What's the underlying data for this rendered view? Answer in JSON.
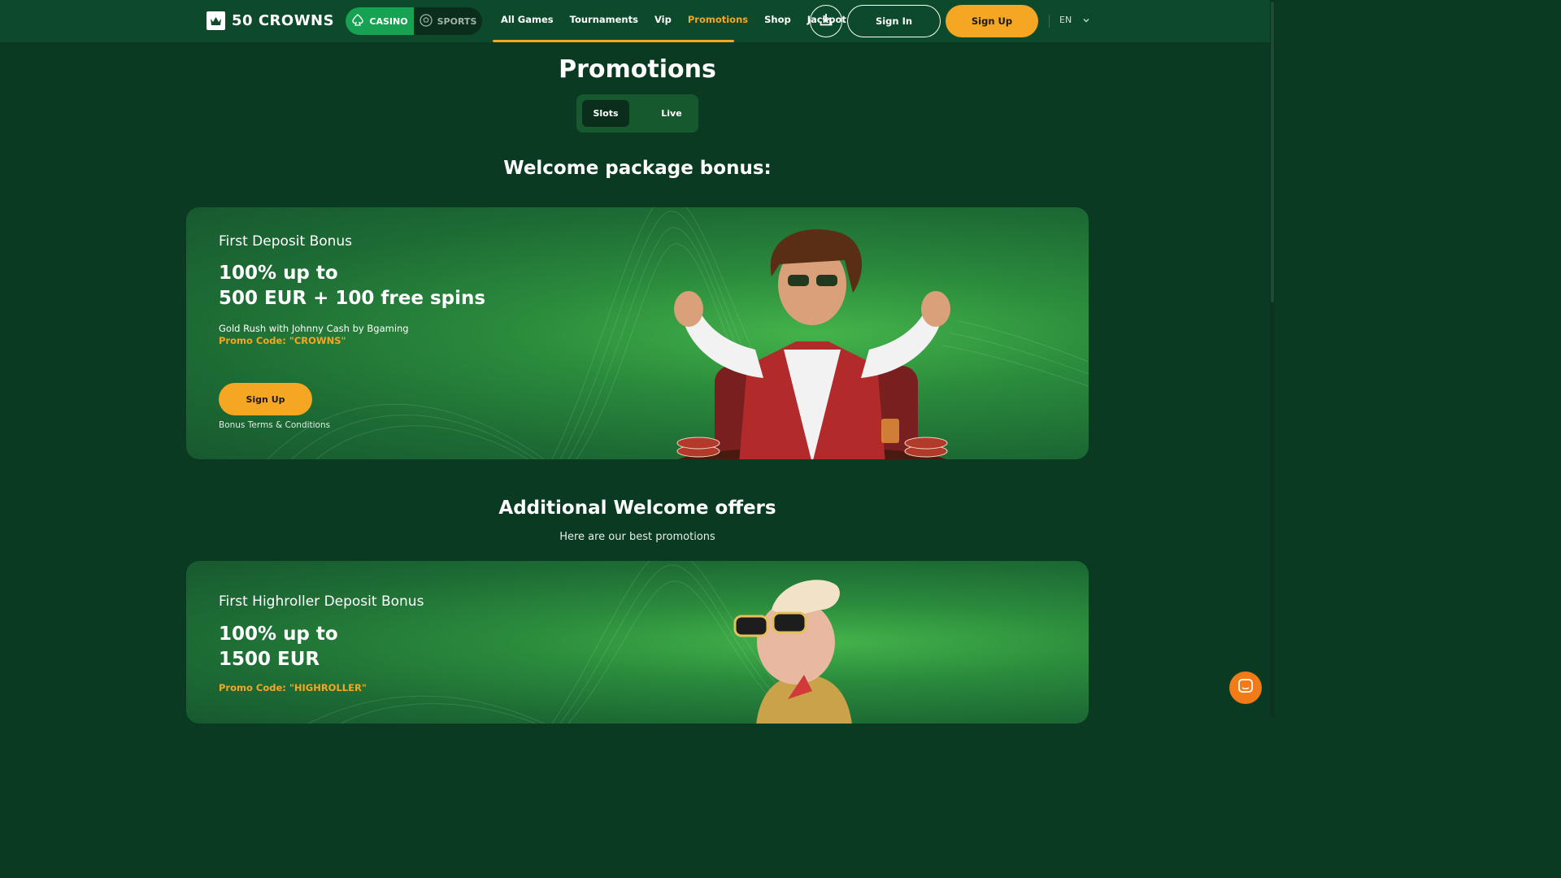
{
  "header": {
    "logo_text": "50 CROWNS",
    "modes": {
      "casino": "CASINO",
      "sports": "SPORTS"
    },
    "nav": [
      "All Games",
      "Tournaments",
      "Vip",
      "Promotions",
      "Shop",
      "Jackpot"
    ],
    "active_nav": "Promotions",
    "sign_in": "Sign In",
    "sign_up": "Sign Up",
    "language": "EN"
  },
  "page": {
    "title": "Promotions",
    "tabs": [
      "Slots",
      "Live"
    ],
    "active_tab": "Slots"
  },
  "welcome": {
    "title": "Welcome package bonus:",
    "card": {
      "heading": "First Deposit Bonus",
      "offer_line1": "100% up to",
      "offer_line2": "500 EUR + 100 free spins",
      "game": "Gold Rush with Johnny Cash by Bgaming",
      "promo_code": "Promo Code: \"CROWNS\"",
      "signup": "Sign Up",
      "terms": "Bonus Terms & Conditions"
    }
  },
  "additional": {
    "title": "Additional Welcome offers",
    "subtitle": "Here are our best promotions",
    "card": {
      "heading": "First Highroller Deposit Bonus",
      "offer_line1": "100% up to",
      "offer_line2": "1500 EUR",
      "promo_code": "Promo Code: \"HIGHROLLER\""
    }
  },
  "colors": {
    "background": "#0a3a22",
    "header": "#0d4a2b",
    "accent": "#f5a623",
    "casino_green": "#17a253",
    "chat": "#f07b18"
  },
  "icons": [
    "crown-logo-icon",
    "spade-icon",
    "soccer-ball-icon",
    "download-icon",
    "chevron-down-icon",
    "chat-icon"
  ]
}
